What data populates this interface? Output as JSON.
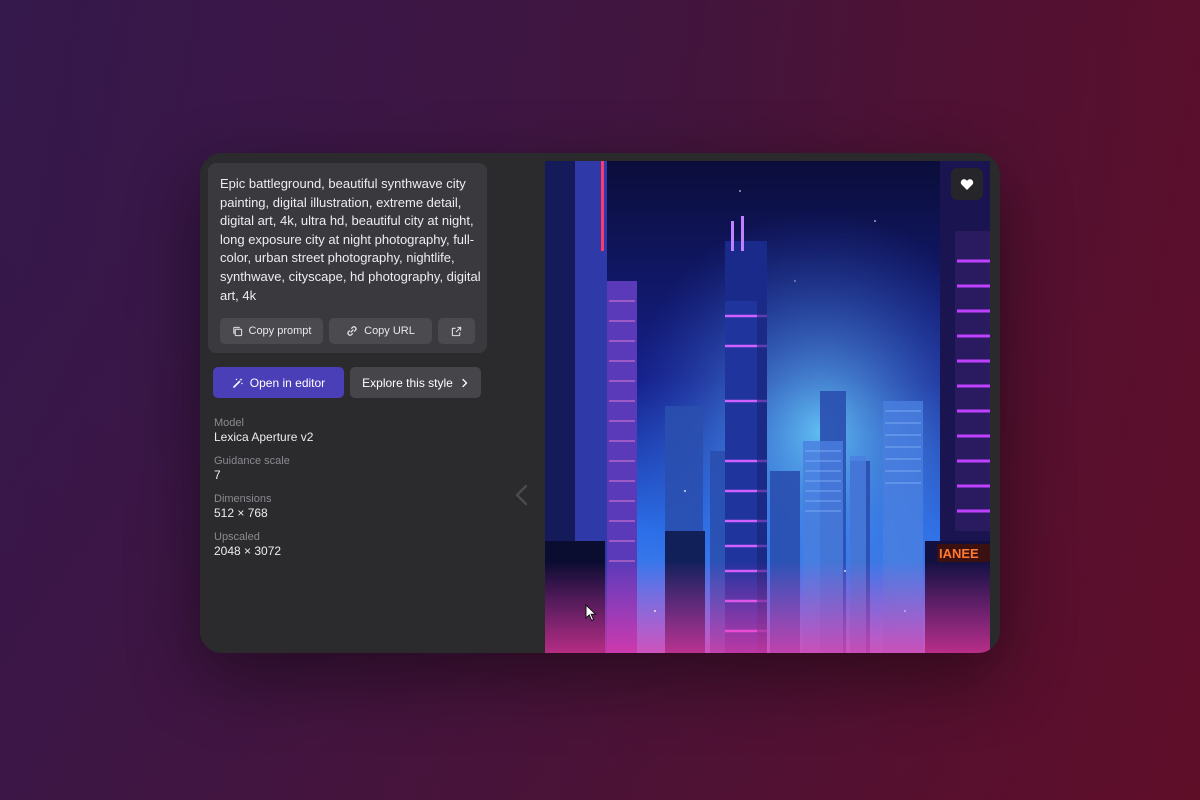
{
  "prompt": {
    "text": "Epic battleground, beautiful synthwave city painting, digital illustration, extreme detail, digital art, 4k, ultra hd, beautiful city at night, long exposure city at night photography, full-color, urban street photography, nightlife, synthwave, cityscape, hd photography, digital art, 4k",
    "copy_prompt_label": "Copy prompt",
    "copy_url_label": "Copy URL"
  },
  "actions": {
    "open_editor_label": "Open in editor",
    "explore_style_label": "Explore this style"
  },
  "meta": {
    "model_label": "Model",
    "model_value": "Lexica Aperture v2",
    "guidance_label": "Guidance scale",
    "guidance_value": "7",
    "dimensions_label": "Dimensions",
    "dimensions_value": "512 × 768",
    "upscaled_label": "Upscaled",
    "upscaled_value": "2048 × 3072"
  },
  "image": {
    "sign_text": "IANEE"
  },
  "icons": {
    "copy": "copy-icon",
    "link": "link-icon",
    "external": "external-link-icon",
    "wand": "magic-wand-icon",
    "chevron": "chevron-right-icon",
    "heart": "heart-icon",
    "prev": "chevron-left-icon"
  },
  "colors": {
    "primary_button": "#4b3fb8",
    "panel": "#2b2b2e",
    "card": "#3a3a3e"
  }
}
